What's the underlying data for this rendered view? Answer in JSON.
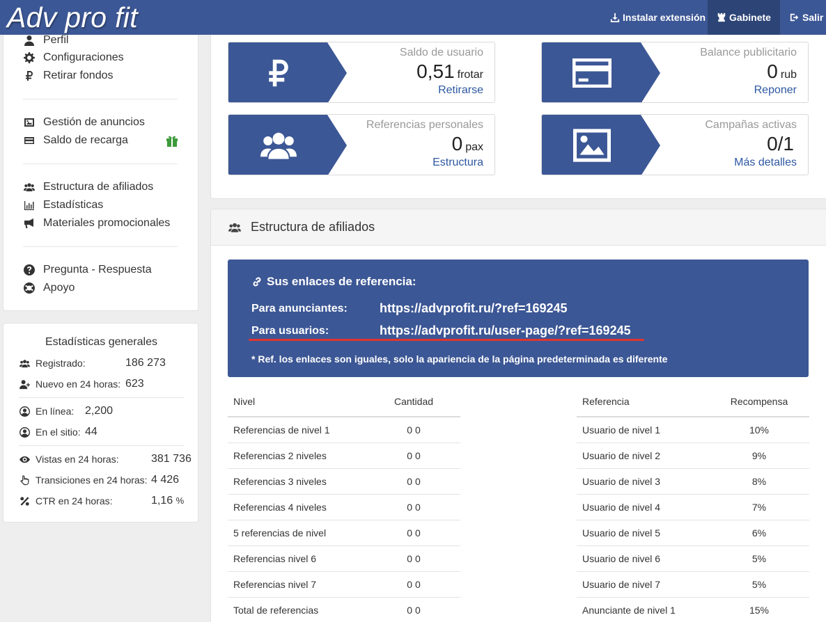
{
  "header": {
    "brand": "Adv pro fit",
    "install_label": "Instalar extensión",
    "cabinet_label": "Gabinete",
    "exit_label": "Salir"
  },
  "sidebar": {
    "groups": [
      [
        {
          "label": "Perfil",
          "icon": "user-icon"
        },
        {
          "label": "Configuraciones",
          "icon": "gear-icon"
        },
        {
          "label": "Retirar fondos",
          "icon": "ruble-icon"
        }
      ],
      [
        {
          "label": "Gestión de anuncios",
          "icon": "image-icon"
        },
        {
          "label": "Saldo de recarga",
          "icon": "credit-card-icon"
        }
      ],
      [
        {
          "label": "Estructura de afiliados",
          "icon": "users-icon"
        },
        {
          "label": "Estadísticas",
          "icon": "bar-chart-icon"
        },
        {
          "label": "Materiales promocionales",
          "icon": "bullhorn-icon"
        }
      ],
      [
        {
          "label": "Pregunta - Respuesta",
          "icon": "question-icon"
        },
        {
          "label": "Apoyo",
          "icon": "life-ring-icon"
        }
      ]
    ],
    "gift_color": "#3d9a3a"
  },
  "stats": {
    "title": "Estadísticas generales",
    "rows": [
      {
        "label": "Registrado:",
        "value": "186 273",
        "icon": "users-icon"
      },
      {
        "label": "Nuevo en 24 horas:",
        "value": "623",
        "icon": "user-plus-icon"
      },
      {
        "label": "En línea:",
        "value": "2,200",
        "icon": "user-circle-icon"
      },
      {
        "label": "En el sitio:",
        "value": "44",
        "icon": "user-circle-icon"
      },
      {
        "label": "Vistas en 24 horas:",
        "value": "381 736",
        "icon": "eye-icon"
      },
      {
        "label": "Transiciones en 24 horas:",
        "value": "4 426",
        "icon": "pointer-hand-icon"
      },
      {
        "label": "CTR en 24 horas:",
        "value": "1,16",
        "unit": "%",
        "icon": "percent-icon"
      }
    ]
  },
  "cards": [
    {
      "label": "Saldo de usuario",
      "value": "0,51",
      "unit": "frotar",
      "link": "Retirarse",
      "icon": "ruble-icon"
    },
    {
      "label": "Balance publicitario",
      "value": "0",
      "unit": "rub",
      "link": "Reponer",
      "icon": "credit-card-icon"
    },
    {
      "label": "Referencias personales",
      "value": "0",
      "unit": "pax",
      "link": "Estructura",
      "icon": "users-icon"
    },
    {
      "label": "Campañas activas",
      "value": "0/1",
      "unit": "",
      "link": "Más detalles",
      "icon": "image-icon"
    }
  ],
  "affiliate": {
    "title": "Estructura de afiliados",
    "ref_title": "Sus enlaces de referencia:",
    "advertisers_label": "Para anunciantes:",
    "advertisers_url": "https://advprofit.ru/?ref=169245",
    "users_label": "Para usuarios:",
    "users_url": "https://advprofit.ru/user-page/?ref=169245",
    "note": "* Ref. los enlaces son iguales, solo la apariencia de la página predeterminada es diferente",
    "levels_table": {
      "headers": [
        "Nivel",
        "Cantidad"
      ],
      "rows": [
        [
          "Referencias de nivel 1",
          "0 0"
        ],
        [
          "Referencias 2 niveles",
          "0 0"
        ],
        [
          "Referencias 3 niveles",
          "0 0"
        ],
        [
          "Referencias 4 niveles",
          "0 0"
        ],
        [
          "5 referencias de nivel",
          "0 0"
        ],
        [
          "Referencias nivel 6",
          "0 0"
        ],
        [
          "Referencias nivel 7",
          "0 0"
        ],
        [
          "Total de referencias",
          "0 0"
        ]
      ]
    },
    "rewards_table": {
      "headers": [
        "Referencia",
        "Recompensa"
      ],
      "rows": [
        [
          "Usuario de nivel 1",
          "10%"
        ],
        [
          "Usuario de nivel 2",
          "9%"
        ],
        [
          "Usuario de nivel 3",
          "8%"
        ],
        [
          "Usuario de nivel 4",
          "7%"
        ],
        [
          "Usuario de nivel 5",
          "6%"
        ],
        [
          "Usuario de nivel 6",
          "5%"
        ],
        [
          "Usuario de nivel 7",
          "5%"
        ],
        [
          "Anunciante de nivel 1",
          "15%"
        ]
      ]
    }
  },
  "colors": {
    "primary": "#3c5795",
    "active_nav": "#2d4576",
    "link": "#2d57a0",
    "underline": "#e3342f"
  }
}
